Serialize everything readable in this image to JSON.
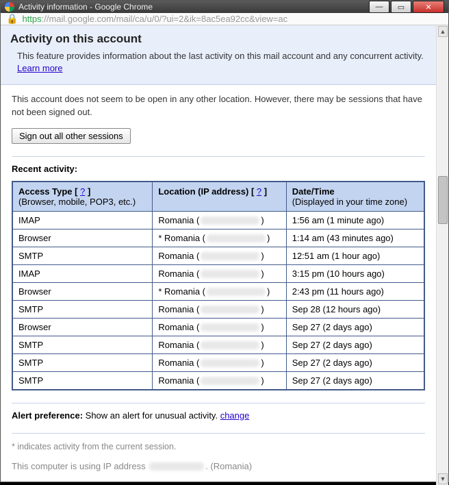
{
  "window": {
    "title": "Activity information - Google Chrome"
  },
  "address": {
    "https": "https",
    "rest": "://mail.google.com/mail/ca/u/0/?ui=2&ik=8ac5ea92cc&view=ac"
  },
  "header": {
    "title": "Activity on this account",
    "desc_prefix": "This feature provides information about the last activity on this mail account and any concurrent activity. ",
    "learn_more": "Learn more"
  },
  "status": "This account does not seem to be open in any other location. However, there may be sessions that have not been signed out.",
  "signout_button": "Sign out all other sessions",
  "recent_label": "Recent activity:",
  "table": {
    "headers": {
      "access_type": "Access Type",
      "access_type_sub": "(Browser, mobile, POP3, etc.)",
      "location": "Location (IP address)",
      "datetime": "Date/Time",
      "datetime_sub": "(Displayed in your time zone)",
      "help_q": "?"
    },
    "location_prefix_plain": "Romania (",
    "location_prefix_star": "* Romania (",
    "location_suffix": ")",
    "rows": [
      {
        "type": "IMAP",
        "star": false,
        "time": "1:56 am (1 minute ago)"
      },
      {
        "type": "Browser",
        "star": true,
        "time": "1:14 am (43 minutes ago)"
      },
      {
        "type": "SMTP",
        "star": false,
        "time": "12:51 am (1 hour ago)"
      },
      {
        "type": "IMAP",
        "star": false,
        "time": "3:15 pm (10 hours ago)"
      },
      {
        "type": "Browser",
        "star": true,
        "time": "2:43 pm (11 hours ago)"
      },
      {
        "type": "SMTP",
        "star": false,
        "time": "Sep 28 (12 hours ago)"
      },
      {
        "type": "Browser",
        "star": false,
        "time": "Sep 27 (2 days ago)"
      },
      {
        "type": "SMTP",
        "star": false,
        "time": "Sep 27 (2 days ago)"
      },
      {
        "type": "SMTP",
        "star": false,
        "time": "Sep 27 (2 days ago)"
      },
      {
        "type": "SMTP",
        "star": false,
        "time": "Sep 27 (2 days ago)"
      }
    ]
  },
  "alert": {
    "label": "Alert preference:",
    "text": " Show an alert for unusual activity. ",
    "change": "change"
  },
  "footnote": "* indicates activity from the current session.",
  "ip_line_prefix": "This computer is using IP address ",
  "ip_line_suffix": ". (Romania)"
}
